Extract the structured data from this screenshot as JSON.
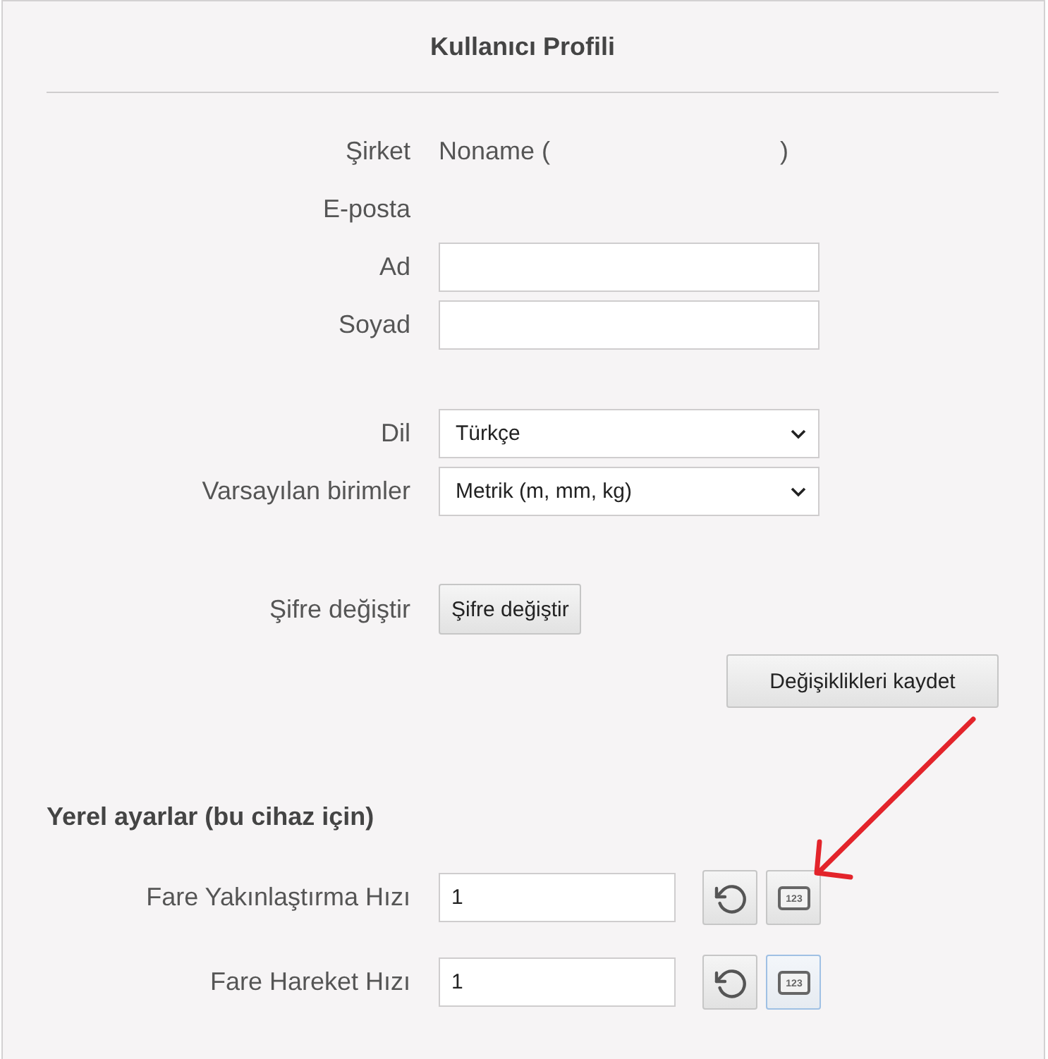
{
  "title": "Kullanıcı Profili",
  "groups": [
    [
      {
        "kind": "text",
        "label": "Şirket",
        "value_before": "Noname (",
        "value_after": ")"
      },
      {
        "kind": "text",
        "label": "E-posta"
      },
      {
        "kind": "input",
        "label": "Ad"
      },
      {
        "kind": "input",
        "label": "Soyad"
      }
    ],
    [
      {
        "kind": "select",
        "label": "Dil",
        "value": "Türkçe"
      },
      {
        "kind": "select",
        "label": "Varsayılan birimler",
        "value": "Metrik (m, mm, kg)"
      }
    ],
    [
      {
        "kind": "button",
        "label": "Şifre değiştir",
        "button": "Şifre değiştir"
      }
    ]
  ],
  "save_button": "Değişiklikleri kaydet",
  "local_settings": {
    "title": "Yerel ayarlar (bu cihaz için)",
    "rows": [
      {
        "label": "Fare Yakınlaştırma Hızı",
        "value": "1",
        "keypad_icon_text": "123",
        "keypad_focused": false
      },
      {
        "label": "Fare Hareket Hızı",
        "value": "1",
        "keypad_icon_text": "123",
        "keypad_focused": true
      }
    ]
  }
}
